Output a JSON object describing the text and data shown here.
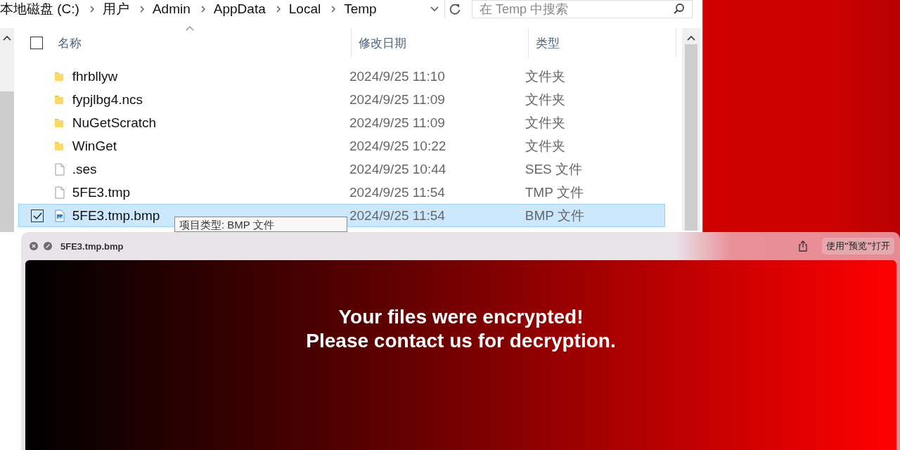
{
  "breadcrumb": [
    "本地磁盘 (C:)",
    "用户",
    "Admin",
    "AppData",
    "Local",
    "Temp"
  ],
  "search": {
    "placeholder": "在 Temp 中搜索"
  },
  "columns": [
    {
      "label": "名称",
      "sorted": true
    },
    {
      "label": "修改日期",
      "sorted": false
    },
    {
      "label": "类型",
      "sorted": false
    }
  ],
  "header_checked": false,
  "rows": [
    {
      "name": "fhrbllyw",
      "modified": "2024/9/25 11:10",
      "type": "文件夹",
      "kind": "folder",
      "selected": false
    },
    {
      "name": "fypjlbg4.ncs",
      "modified": "2024/9/25 11:09",
      "type": "文件夹",
      "kind": "folder",
      "selected": false
    },
    {
      "name": "NuGetScratch",
      "modified": "2024/9/25 11:09",
      "type": "文件夹",
      "kind": "folder",
      "selected": false
    },
    {
      "name": "WinGet",
      "modified": "2024/9/25 10:22",
      "type": "文件夹",
      "kind": "folder",
      "selected": false
    },
    {
      "name": ".ses",
      "modified": "2024/9/25 10:44",
      "type": "SES 文件",
      "kind": "file",
      "selected": false
    },
    {
      "name": "5FE3.tmp",
      "modified": "2024/9/25 11:54",
      "type": "TMP 文件",
      "kind": "file",
      "selected": false
    },
    {
      "name": "5FE3.tmp.bmp",
      "modified": "2024/9/25 11:54",
      "type": "BMP 文件",
      "kind": "image",
      "selected": true
    }
  ],
  "tooltip": {
    "text": "项目类型: BMP 文件"
  },
  "preview": {
    "title": "5FE3.tmp.bmp",
    "open_button": "使用“预览”打开",
    "message": [
      "Your files were encrypted!",
      "Please contact us for decryption."
    ]
  }
}
